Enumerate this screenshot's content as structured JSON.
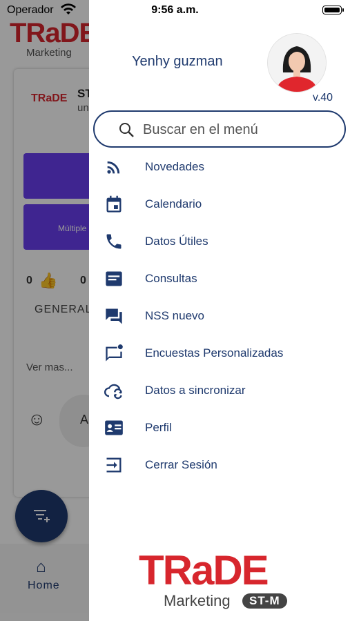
{
  "status_bar": {
    "carrier": "Operador",
    "time": "9:56 a.m."
  },
  "background": {
    "logo_text": "TRaDE",
    "logo_sub": "Marketing",
    "card_title": "ST",
    "card_sub": "un",
    "purple_button": "Múltiple",
    "likes": "0",
    "likes2": "0",
    "category": "GENERAL",
    "see_more": "Ver mas...",
    "comment_initial": "A",
    "nav_home": "Home"
  },
  "drawer": {
    "user_name": "Yenhy guzman",
    "version": "v.40",
    "search": {
      "placeholder": "Buscar en el menú"
    },
    "menu": [
      {
        "label": "Novedades",
        "icon": "rss-feed-icon"
      },
      {
        "label": "Calendario",
        "icon": "calendar-icon"
      },
      {
        "label": "Datos Útiles",
        "icon": "phone-icon"
      },
      {
        "label": "Consultas",
        "icon": "inbox-icon"
      },
      {
        "label": "NSS nuevo",
        "icon": "chat-icon"
      },
      {
        "label": "Encuestas Personalizadas",
        "icon": "chat-notification-icon"
      },
      {
        "label": "Datos a sincronizar",
        "icon": "cloud-sync-icon"
      },
      {
        "label": "Perfil",
        "icon": "id-card-icon"
      },
      {
        "label": "Cerrar Sesión",
        "icon": "logout-icon"
      }
    ],
    "brand": {
      "word": "TRaDE",
      "sub": "Marketing",
      "badge": "ST-M"
    }
  },
  "colors": {
    "primary": "#1f3a6e",
    "brand_red": "#d7262d",
    "accent_purple": "#6a3ff0"
  }
}
